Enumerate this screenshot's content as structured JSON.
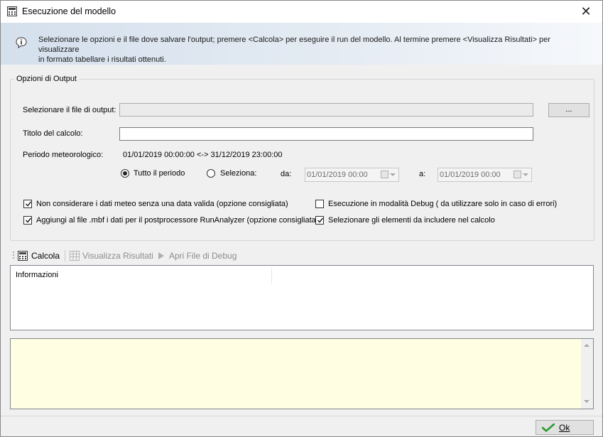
{
  "window": {
    "title": "Esecuzione del modello",
    "close_glyph": "✕"
  },
  "info": {
    "icon": "info-bubble-icon",
    "line1": "Selezionare le opzioni e il file dove salvare l'output; premere <Calcola> per eseguire il run del modello. Al termine premere <Visualizza Risultati> per visualizzare",
    "line2": "in formato tabellare i risultati ottenuti."
  },
  "output_options": {
    "legend": "Opzioni di Output",
    "output_file_label": "Selezionare il file di output:",
    "output_file_value": "",
    "browse_label": "...",
    "calc_title_label": "Titolo del calcolo:",
    "calc_title_value": "",
    "met_period_label": "Periodo meteorologico:",
    "met_period_value": "01/01/2019 00:00:00 <-> 31/12/2019 23:00:00",
    "radio_whole_period": "Tutto il periodo",
    "radio_select": "Seleziona:",
    "selected_radio": "whole_period",
    "from_label": "da:",
    "from_value": "01/01/2019 00:00",
    "to_label": "a:",
    "to_value": "01/01/2019 00:00",
    "checkboxes": [
      {
        "label": "Non considerare i dati meteo senza una data valida (opzione consigliata)",
        "checked": true
      },
      {
        "label": "Esecuzione in modalità Debug ( da utilizzare solo in caso di errori)",
        "checked": false
      },
      {
        "label": "Aggiungi al file .mbf i dati per il postprocessore RunAnalyzer (opzione consigliata)",
        "checked": true
      },
      {
        "label": "Selezionare gli elementi da includere nel calcolo",
        "checked": true
      }
    ]
  },
  "toolbar": {
    "calcola": "Calcola",
    "visualizza_risultati": "Visualizza Risultati",
    "apri_debug": "Apri File di Debug"
  },
  "listview": {
    "columns": [
      "Informazioni",
      ""
    ]
  },
  "footer": {
    "ok_label": "Ok"
  },
  "colors": {
    "log_background": "#fffde2",
    "banner_start": "#d5e0ed",
    "ok_check": "#2e9b2e"
  }
}
